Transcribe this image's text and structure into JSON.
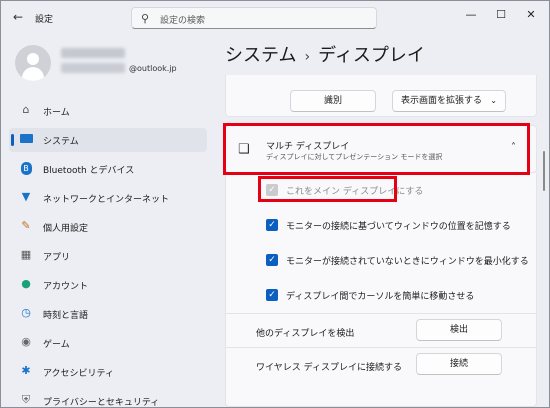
{
  "window": {
    "title": "設定",
    "back_icon": "back-arrow-icon"
  },
  "search": {
    "placeholder": "設定の検索"
  },
  "profile": {
    "email": "@outlook.jp"
  },
  "nav": {
    "items": [
      {
        "label": "ホーム",
        "icon": "home-icon"
      },
      {
        "label": "システム",
        "icon": "system-icon"
      },
      {
        "label": "Bluetooth とデバイス",
        "icon": "bluetooth-icon"
      },
      {
        "label": "ネットワークとインターネット",
        "icon": "wifi-icon"
      },
      {
        "label": "個人用設定",
        "icon": "brush-icon"
      },
      {
        "label": "アプリ",
        "icon": "apps-icon"
      },
      {
        "label": "アカウント",
        "icon": "account-icon"
      },
      {
        "label": "時刻と言語",
        "icon": "globe-clock-icon"
      },
      {
        "label": "ゲーム",
        "icon": "gamepad-icon"
      },
      {
        "label": "アクセシビリティ",
        "icon": "accessibility-icon"
      },
      {
        "label": "プライバシーとセキュリティ",
        "icon": "shield-icon"
      }
    ]
  },
  "breadcrumb": {
    "parent": "システム",
    "current": "ディスプレイ"
  },
  "top_buttons": {
    "identify": "識別",
    "extend": "表示画面を拡張する"
  },
  "multi_display": {
    "title": "マルチ ディスプレイ",
    "subtitle": "ディスプレイに対してプレゼンテーション モードを選択"
  },
  "options": {
    "main_display": "これをメイン ディスプレイにする",
    "remember_window": "モニターの接続に基づいてウィンドウの位置を記憶する",
    "minimize_window": "モニターが接続されていないときにウィンドウを最小化する",
    "move_cursor": "ディスプレイ間でカーソルを簡単に移動させる"
  },
  "detect": {
    "label": "他のディスプレイを検出",
    "button": "検出"
  },
  "wireless": {
    "label": "ワイヤレス ディスプレイに接続する",
    "button": "接続"
  }
}
